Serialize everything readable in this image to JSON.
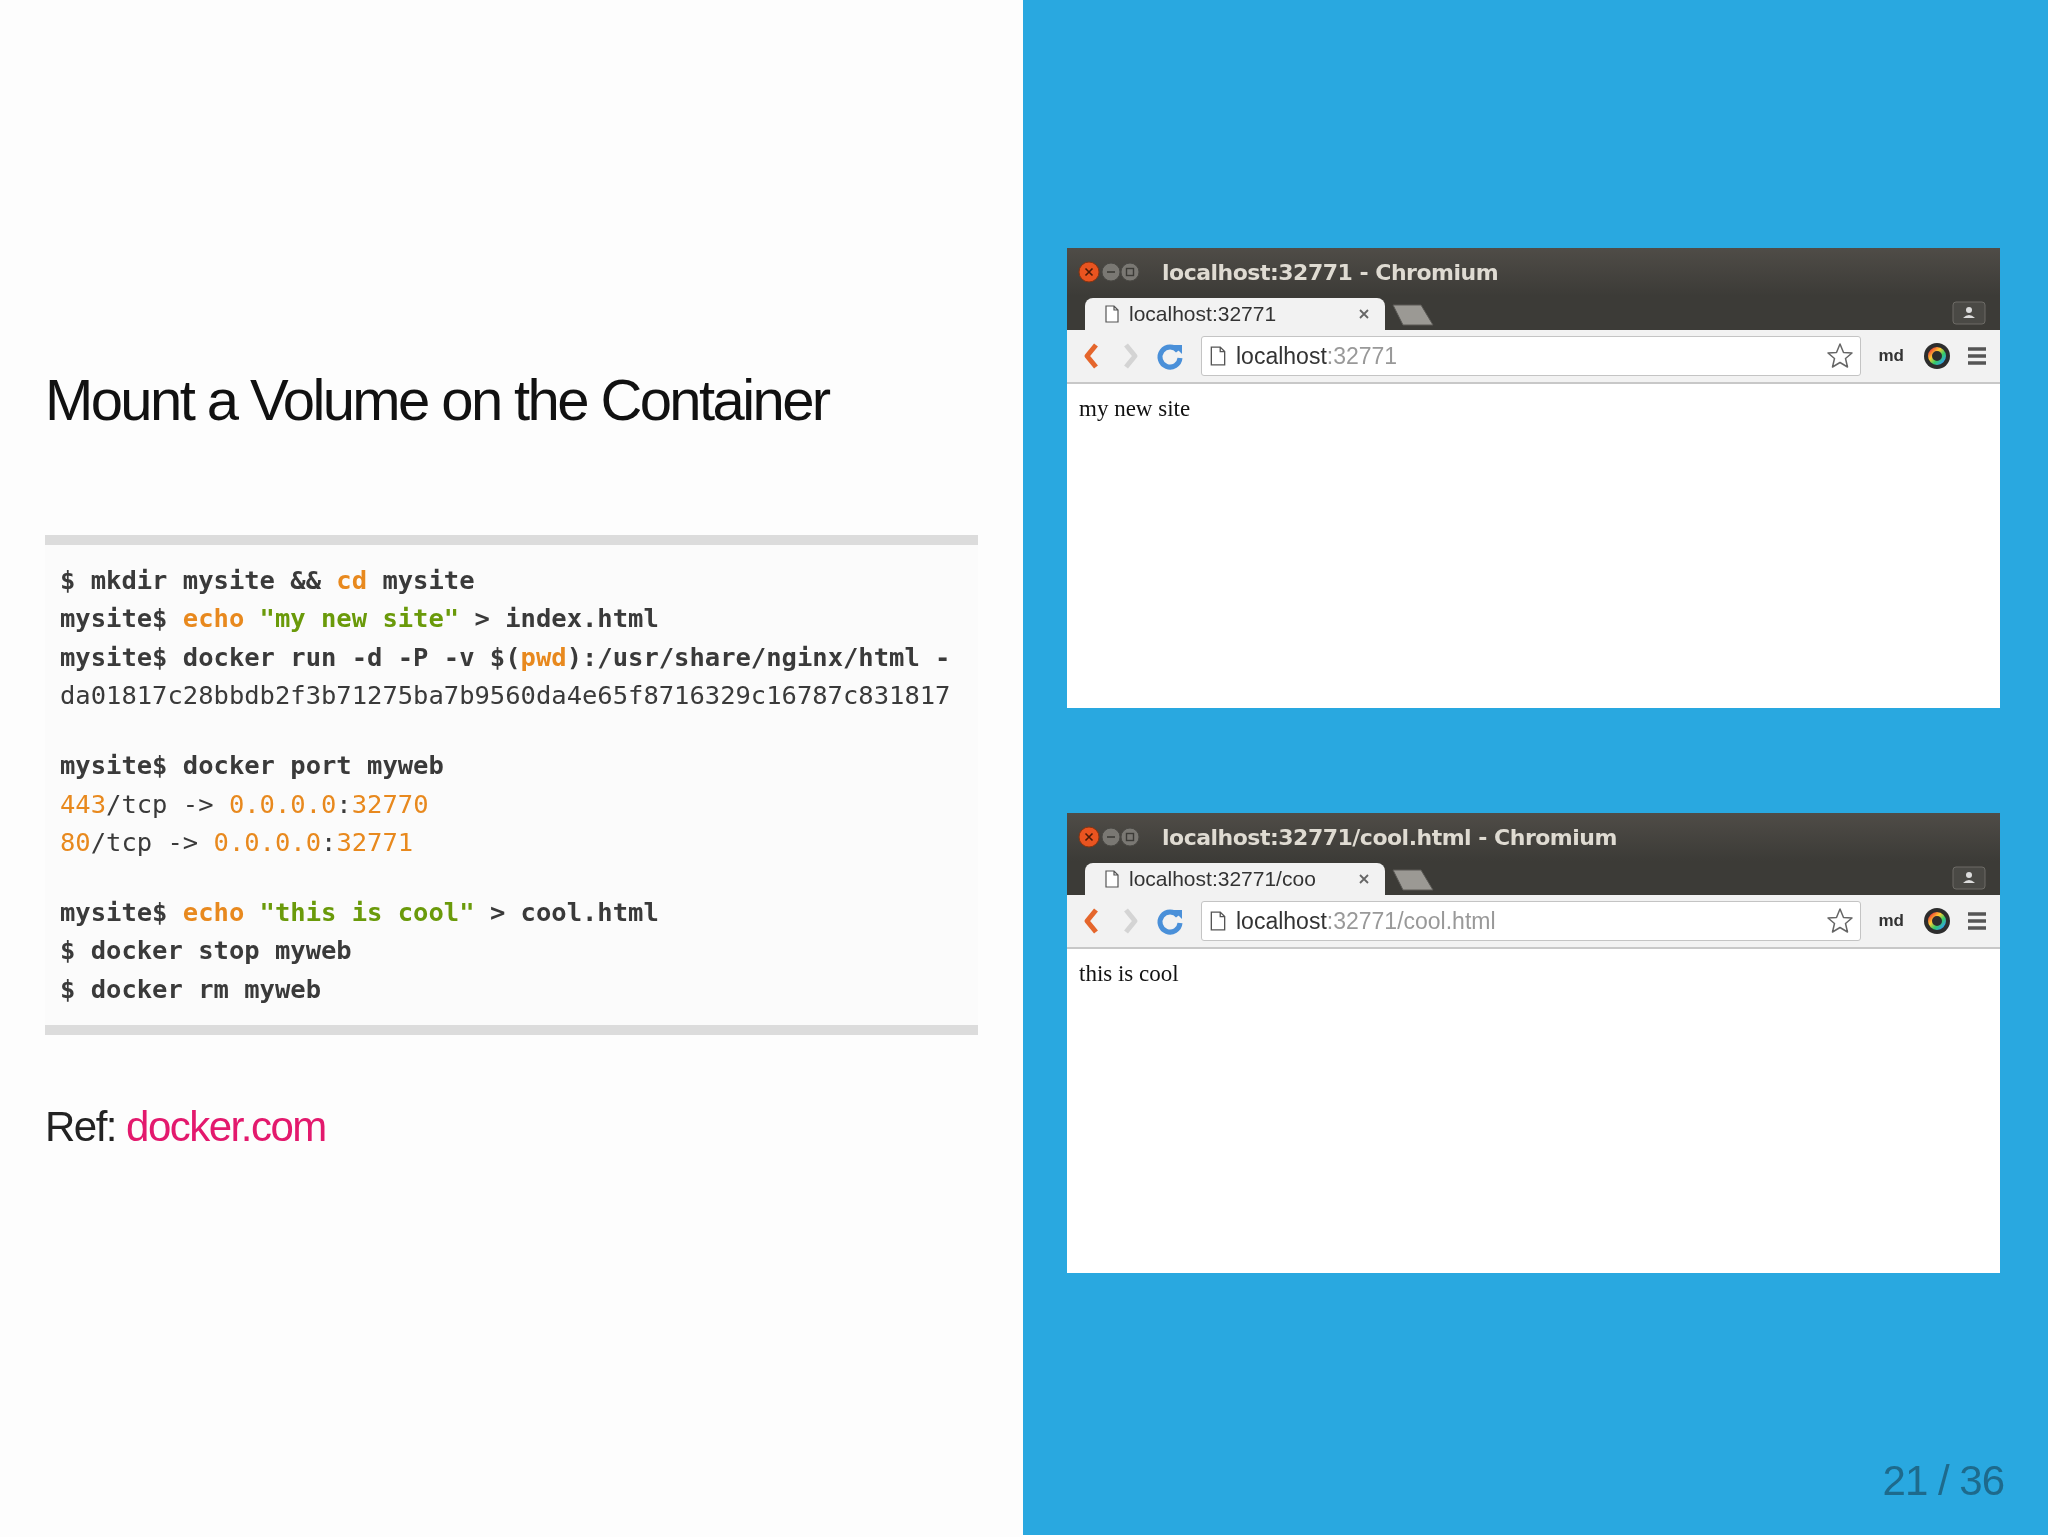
{
  "title": "Mount a Volume on the Container",
  "code_groups": [
    [
      [
        {
          "text": "$ mkdir mysite && ",
          "kind": "cmd"
        },
        {
          "text": "cd",
          "kind": "kw"
        },
        {
          "text": " mysite",
          "kind": "cmd"
        }
      ],
      [
        {
          "text": "mysite$ ",
          "kind": "cmd"
        },
        {
          "text": "echo ",
          "kind": "kw"
        },
        {
          "text": "\"my new site\"",
          "kind": "str"
        },
        {
          "text": " > index.html",
          "kind": "cmd"
        }
      ],
      [
        {
          "text": "mysite$ docker run -d -P -v $(",
          "kind": "cmd"
        },
        {
          "text": "pwd",
          "kind": "kw"
        },
        {
          "text": "):/usr/share/nginx/html -",
          "kind": "cmd"
        }
      ],
      [
        {
          "text": "da01817c28bbdb2f3b71275ba7b9560da4e65f8716329c16787c831817",
          "kind": "out"
        }
      ]
    ],
    [
      [
        {
          "text": "mysite$ docker port myweb",
          "kind": "cmd"
        }
      ],
      [
        {
          "text": "443",
          "kind": "num"
        },
        {
          "text": "/tcp -> ",
          "kind": "out"
        },
        {
          "text": "0.0.0.0",
          "kind": "num"
        },
        {
          "text": ":",
          "kind": "out"
        },
        {
          "text": "32770",
          "kind": "num"
        }
      ],
      [
        {
          "text": "80",
          "kind": "num"
        },
        {
          "text": "/tcp -> ",
          "kind": "out"
        },
        {
          "text": "0.0.0.0",
          "kind": "num"
        },
        {
          "text": ":",
          "kind": "out"
        },
        {
          "text": "32771",
          "kind": "num"
        }
      ]
    ],
    [
      [
        {
          "text": "mysite$ ",
          "kind": "cmd"
        },
        {
          "text": "echo ",
          "kind": "kw"
        },
        {
          "text": "\"this is cool\"",
          "kind": "str"
        },
        {
          "text": " > cool.html",
          "kind": "cmd"
        }
      ],
      [
        {
          "text": "$ docker stop myweb",
          "kind": "cmd"
        }
      ],
      [
        {
          "text": "$ docker rm myweb",
          "kind": "cmd"
        }
      ]
    ]
  ],
  "ref": {
    "label": "Ref:",
    "link": "docker.com"
  },
  "browsers": [
    {
      "title": "localhost:32771 - Chromium",
      "tab_label": "localhost:32771",
      "url_host": "localhost",
      "url_rest": ":32771",
      "extension_label": "md",
      "page_text": "my new site"
    },
    {
      "title": "localhost:32771/cool.html - Chromium",
      "tab_label": "localhost:32771/coo",
      "url_host": "localhost",
      "url_rest": ":32771/cool.html",
      "extension_label": "md",
      "page_text": "this is cool"
    }
  ],
  "slide_number": "21 / 36"
}
